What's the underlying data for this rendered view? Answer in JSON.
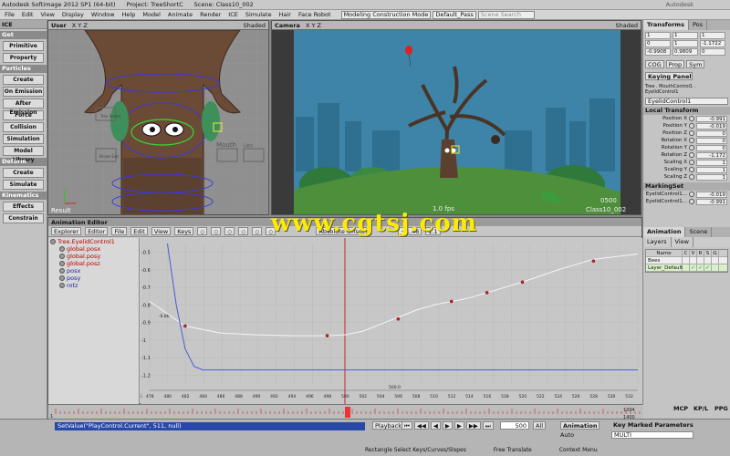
{
  "titlebar": {
    "app": "Autodesk Softimage 2012 SP1 (64-bit)",
    "project": "Project: TreeShortC",
    "scene": "Scene: Class10_002",
    "brand": "Autodesk"
  },
  "menu": [
    "File",
    "Edit",
    "View",
    "Display",
    "Window",
    "Help",
    "Model",
    "Animate",
    "Render",
    "ICE",
    "Simulate",
    "Hair",
    "Face Robot"
  ],
  "mode_combo": "Modeling Construction Mode",
  "pass_combo": "Default_Pass",
  "scene_search": "Scene Search",
  "left": {
    "header": "ICE",
    "items": [
      {
        "type": "sec",
        "label": "Get"
      },
      {
        "type": "btn",
        "label": "Primitive"
      },
      {
        "type": "btn",
        "label": "Property"
      },
      {
        "type": "sec",
        "label": "Particles"
      },
      {
        "type": "btn",
        "label": "Create"
      },
      {
        "type": "btn",
        "label": "On Emission"
      },
      {
        "type": "btn",
        "label": "After Emission"
      },
      {
        "type": "btn",
        "label": "Force"
      },
      {
        "type": "btn",
        "label": "Collision"
      },
      {
        "type": "btn",
        "label": "Simulation"
      },
      {
        "type": "btn",
        "label": "Model Library"
      },
      {
        "type": "sec",
        "label": "Deform"
      },
      {
        "type": "btn",
        "label": "Create"
      },
      {
        "type": "btn",
        "label": "Simulate"
      },
      {
        "type": "sec",
        "label": "Kinematics"
      },
      {
        "type": "btn",
        "label": "Effects"
      },
      {
        "type": "btn",
        "label": "Constrain"
      }
    ]
  },
  "vp_user": {
    "label": "User",
    "axes": "X Y Z",
    "shading": "Shaded",
    "footer": "Result",
    "text": {
      "mouth": "Mouth",
      "lips": "Lips",
      "tree_sel": "Tree Select",
      "brows": "Brows Extr"
    }
  },
  "vp_cam": {
    "label": "Camera",
    "axes": "X Y Z",
    "shading": "Shaded",
    "fps": "1.0 fps",
    "frame": "0500",
    "name": "Class10_002"
  },
  "right": {
    "tabs": [
      "Transforms",
      "Pos"
    ],
    "trans_rows": [
      [
        "1",
        "1",
        "1"
      ],
      [
        "0",
        "1",
        "-1.1722"
      ],
      [
        "-0.9908",
        "0.9809",
        "0"
      ]
    ],
    "btns": [
      "COG",
      "Prop",
      "Sym"
    ],
    "keying": "Keying Panel",
    "path": "Tree . MouthControl1 . EyelidControl1",
    "name": "EyelidControl1",
    "local_label": "Local Transform",
    "local": [
      {
        "k": "Position X",
        "v": "-0.991"
      },
      {
        "k": "Position Y",
        "v": "-0.019"
      },
      {
        "k": "Position Z",
        "v": "0"
      },
      {
        "k": "Rotation X",
        "v": "0"
      },
      {
        "k": "Rotation Y",
        "v": "0"
      },
      {
        "k": "Rotation Z",
        "v": "-1.172"
      },
      {
        "k": "Scaling X",
        "v": "1"
      },
      {
        "k": "Scaling Y",
        "v": "1"
      },
      {
        "k": "Scaling Z",
        "v": "1"
      }
    ],
    "markset_label": "MarkingSet",
    "markset": [
      {
        "k": "EyelidControl1...",
        "v": "-0.019"
      },
      {
        "k": "EyelidControl1...",
        "v": "-0.991"
      }
    ],
    "bottom_tabs": [
      "Animation",
      "Scene"
    ],
    "layer_tabs": [
      "Layers",
      "View"
    ],
    "layer_cols": [
      "Name",
      "C",
      "V",
      "R",
      "S",
      "G"
    ],
    "layers": [
      "Bees",
      "Layer_Default"
    ]
  },
  "animed": {
    "title": "Animation Editor",
    "tabs": [
      "Explorer",
      "Editor",
      "File",
      "Edit",
      "View",
      "Keys"
    ],
    "absolute": "Absolute Offset",
    "val1": "+1.46",
    "val2": "1.1",
    "tree_root": "Tree.EyelidControl1",
    "curves": [
      "global.posx",
      "global.posy",
      "global.posz",
      "posx",
      "posy",
      "rotz"
    ],
    "y_ticks": [
      "-0.5",
      "-0.6",
      "-0.7",
      "-0.8",
      "-0.9",
      "-1",
      "-1.1",
      "-1.2"
    ],
    "y_extra": "-0.86",
    "cursor_label": "500.0",
    "x_ticks": [
      "G",
      "478",
      "480",
      "482",
      "484",
      "486",
      "488",
      "490",
      "492",
      "494",
      "496",
      "498",
      "500",
      "502",
      "504",
      "506",
      "508",
      "510",
      "512",
      "514",
      "516",
      "518",
      "520",
      "522",
      "524",
      "526",
      "528",
      "530",
      "532"
    ]
  },
  "chart_data": {
    "type": "line",
    "xlim": [
      478,
      533
    ],
    "ylim": [
      -1.25,
      -0.45
    ],
    "current_frame": 500,
    "series": [
      {
        "name": "posx",
        "color": "#f5f5f5",
        "x": [
          478,
          482,
          486,
          490,
          494,
          498,
          500,
          502,
          504,
          506,
          508,
          510,
          512,
          514,
          516,
          518,
          520,
          524,
          528,
          533
        ],
        "y": [
          -0.78,
          -0.92,
          -0.96,
          -0.97,
          -0.975,
          -0.975,
          -0.97,
          -0.95,
          -0.91,
          -0.87,
          -0.83,
          -0.8,
          -0.78,
          -0.76,
          -0.73,
          -0.7,
          -0.67,
          -0.6,
          -0.54,
          -0.51
        ]
      },
      {
        "name": "rotz",
        "color": "#4a5bd6",
        "x": [
          480,
          481,
          482,
          483,
          484,
          490,
          500,
          510,
          520,
          533
        ],
        "y": [
          -0.45,
          -0.8,
          -1.05,
          -1.15,
          -1.17,
          -1.17,
          -1.17,
          -1.17,
          -1.17,
          -1.17
        ]
      }
    ],
    "keys": [
      {
        "x": 482,
        "y": -0.92
      },
      {
        "x": 498,
        "y": -0.975
      },
      {
        "x": 506,
        "y": -0.88
      },
      {
        "x": 512,
        "y": -0.78
      },
      {
        "x": 516,
        "y": -0.73
      },
      {
        "x": 520,
        "y": -0.67
      },
      {
        "x": 528,
        "y": -0.55
      }
    ]
  },
  "timeline": {
    "start": "1",
    "end": "1394",
    "end2": "1400",
    "current": "500"
  },
  "bottom": {
    "cmd": "SetValue(\"PlayControl.Current\", 511, null)",
    "playback": "Playback",
    "frame": "500",
    "all": "All",
    "animation": "Animation",
    "auto": "Auto",
    "key_params": "Key Marked Parameters",
    "multi": "MULTI",
    "mcp": "MCP",
    "kpl": "KP/L",
    "ppg": "PPG",
    "status": [
      "Rectangle Select Keys/Curves/Slopes",
      "Free Translate",
      "Context Menu"
    ]
  },
  "watermark": "www.cgtsj.com"
}
